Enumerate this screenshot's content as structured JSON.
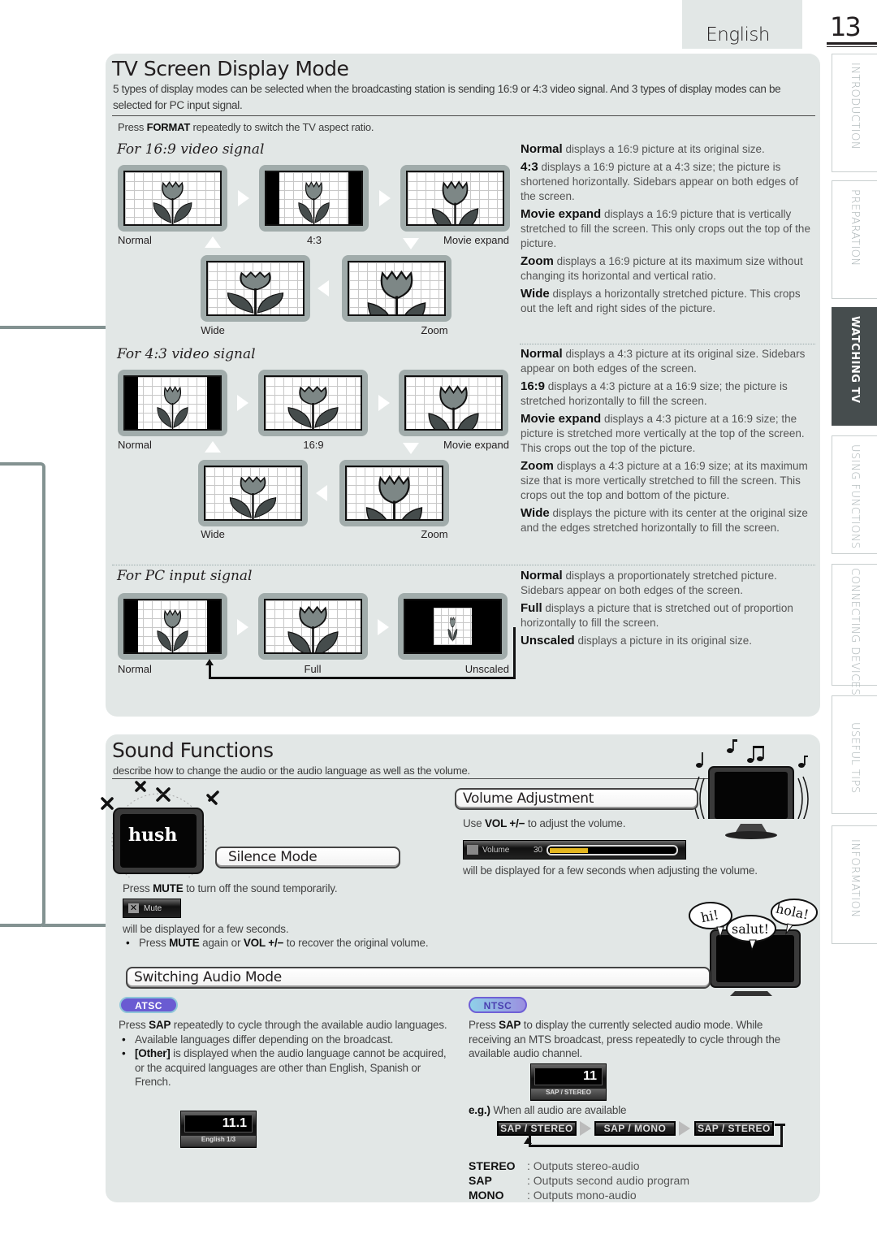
{
  "header": {
    "language": "English",
    "page_number": "13"
  },
  "side_tabs": [
    {
      "label": "INTRODUCTION",
      "active": false
    },
    {
      "label": "PREPARATION",
      "active": false
    },
    {
      "label": "WATCHING TV",
      "active": true
    },
    {
      "label": "USING FUNCTIONS",
      "active": false
    },
    {
      "label": "CONNECTING DEVICES",
      "active": false
    },
    {
      "label": "USEFUL TIPS",
      "active": false
    },
    {
      "label": "INFORMATION",
      "active": false
    }
  ],
  "display_mode": {
    "title": "TV Screen Display Mode",
    "intro": "5 types of display modes can be selected when the broadcasting station is sending 16:9 or 4:3 video signal. And 3 types of display modes can be selected for PC input signal.",
    "instruction_pre": "Press ",
    "instruction_key": "FORMAT",
    "instruction_post": " repeatedly to switch the TV aspect ratio.",
    "sections": [
      {
        "heading": "For 16:9 video signal",
        "modes": [
          "Normal",
          "4:3",
          "Movie expand",
          "Zoom",
          "Wide"
        ],
        "descriptions": [
          {
            "term": "Normal",
            "text": " displays a 16:9 picture at its original size."
          },
          {
            "term": "4:3",
            "text": " displays a 16:9 picture at a 4:3 size; the picture is shortened horizontally. Sidebars appear on both edges of the screen."
          },
          {
            "term": "Movie expand",
            "text": " displays a 16:9 picture that is vertically stretched to fill the screen. This only crops out the top of the picture."
          },
          {
            "term": "Zoom",
            "text": " displays a 16:9 picture at its maximum size without changing its horizontal and vertical ratio."
          },
          {
            "term": "Wide",
            "text": " displays a horizontally stretched picture. This crops out the left and right sides of the picture."
          }
        ]
      },
      {
        "heading": "For 4:3 video signal",
        "modes": [
          "Normal",
          "16:9",
          "Movie expand",
          "Zoom",
          "Wide"
        ],
        "descriptions": [
          {
            "term": "Normal",
            "text": " displays a 4:3 picture at its original size. Sidebars appear on both edges of the screen."
          },
          {
            "term": "16:9",
            "text": " displays a 4:3 picture at a 16:9 size; the picture is stretched horizontally to fill the screen."
          },
          {
            "term": "Movie expand",
            "text": " displays a 4:3 picture at a 16:9 size; the picture is stretched more vertically at the top of the screen. This crops out the top of the picture."
          },
          {
            "term": "Zoom",
            "text": " displays a 4:3 picture at a 16:9 size; at its maximum size that is more vertically stretched to fill the screen. This crops out the top and bottom of the picture."
          },
          {
            "term": "Wide",
            "text": " displays the picture with its center at the original size and the edges stretched horizontally to fill the screen."
          }
        ]
      },
      {
        "heading": "For PC input signal",
        "modes": [
          "Normal",
          "Full",
          "Unscaled"
        ],
        "descriptions": [
          {
            "term": "Normal",
            "text": " displays a proportionately stretched picture. Sidebars appear on both edges of the screen."
          },
          {
            "term": "Full",
            "text": " displays a picture that is stretched out of proportion horizontally to fill the screen."
          },
          {
            "term": "Unscaled",
            "text": " displays a picture in its original size."
          }
        ]
      }
    ]
  },
  "sound": {
    "title": "Sound Functions",
    "intro": "describe how to change the audio or the audio language as well as the volume.",
    "illustration_text": "hush",
    "speech_bubbles": [
      "hi!",
      "salut!",
      "hola!"
    ],
    "volume": {
      "heading": "Volume Adjustment",
      "instr_pre": "Use ",
      "instr_key": "VOL +/−",
      "instr_post": " to adjust the volume.",
      "osd_label": "Volume",
      "osd_value": "30",
      "osd_fill_percent": 30,
      "note": "will be displayed for a few seconds when adjusting the volume."
    },
    "silence": {
      "heading": "Silence Mode",
      "instr_pre": "Press ",
      "instr_key": "MUTE",
      "instr_post": " to turn off the sound temporarily.",
      "osd_label": "Mute",
      "note": "will be displayed for a few seconds.",
      "bullet_pre": "Press ",
      "bullet_key1": "MUTE",
      "bullet_mid": " again or ",
      "bullet_key2": "VOL +/−",
      "bullet_post": " to recover the original volume."
    },
    "switching": {
      "heading": "Switching Audio Mode",
      "atsc": {
        "badge": "ATSC",
        "instr_pre": "Press ",
        "instr_key": "SAP",
        "instr_post": " repeatedly to cycle through the available audio languages.",
        "bullet1": "Available languages differ depending on the broadcast.",
        "bullet2_key": "[Other]",
        "bullet2_text": " is displayed when the audio language cannot be acquired, or the acquired languages are other than English, Spanish or French.",
        "osd_channel": "11.1",
        "osd_sub": "English 1/3"
      },
      "ntsc": {
        "badge": "NTSC",
        "instr_pre": "Press ",
        "instr_key": "SAP",
        "instr_post": " to display the currently selected audio mode. While receiving an MTS broadcast, press repeatedly to cycle through the available audio channel.",
        "osd_channel": "11",
        "osd_sub": "SAP / STEREO",
        "example_key": "e.g.)",
        "example_text": " When all audio are available",
        "cycle": [
          "SAP / STEREO",
          "SAP / MONO",
          "SAP / STEREO"
        ],
        "legend": [
          {
            "key": "STEREO",
            "value": ": Outputs stereo-audio"
          },
          {
            "key": "SAP",
            "value": ": Outputs second audio program"
          },
          {
            "key": "MONO",
            "value": ": Outputs mono-audio"
          }
        ]
      }
    }
  }
}
